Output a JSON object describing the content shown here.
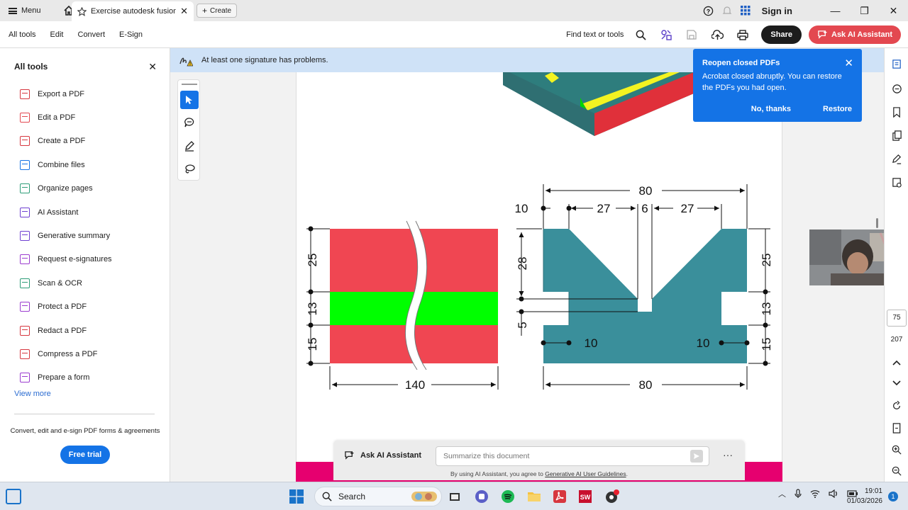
{
  "window": {
    "menu_label": "Menu",
    "tab_title": "Exercise autodesk fusion...",
    "create_label": "Create",
    "sign_in": "Sign in"
  },
  "toolbar": {
    "menus": [
      "All tools",
      "Edit",
      "Convert",
      "E-Sign"
    ],
    "find_text": "Find text or tools",
    "share_label": "Share",
    "ask_ai_label": "Ask AI Assistant"
  },
  "left_panel": {
    "title": "All tools",
    "items": [
      {
        "label": "Export a PDF",
        "icon": "export-pdf-icon",
        "color": "#d7373f"
      },
      {
        "label": "Edit a PDF",
        "icon": "edit-pdf-icon",
        "color": "#e34850"
      },
      {
        "label": "Create a PDF",
        "icon": "create-pdf-icon",
        "color": "#d7373f"
      },
      {
        "label": "Combine files",
        "icon": "combine-files-icon",
        "color": "#1473e6"
      },
      {
        "label": "Organize pages",
        "icon": "organize-pages-icon",
        "color": "#2d9d78"
      },
      {
        "label": "AI Assistant",
        "icon": "ai-assistant-icon",
        "color": "#6e3fd1"
      },
      {
        "label": "Generative summary",
        "icon": "generative-summary-icon",
        "color": "#6e3fd1"
      },
      {
        "label": "Request e-signatures",
        "icon": "request-esign-icon",
        "color": "#9b3ccf"
      },
      {
        "label": "Scan & OCR",
        "icon": "scan-ocr-icon",
        "color": "#2d9d78"
      },
      {
        "label": "Protect a PDF",
        "icon": "protect-pdf-icon",
        "color": "#9b3ccf"
      },
      {
        "label": "Redact a PDF",
        "icon": "redact-pdf-icon",
        "color": "#d7373f"
      },
      {
        "label": "Compress a PDF",
        "icon": "compress-pdf-icon",
        "color": "#d7373f"
      },
      {
        "label": "Prepare a form",
        "icon": "prepare-form-icon",
        "color": "#9b3ccf"
      }
    ],
    "view_more": "View more",
    "promo": "Convert, edit and e-sign PDF forms & agreements",
    "free_trial": "Free trial"
  },
  "banner": {
    "message": "At least one signature has problems."
  },
  "toast": {
    "title": "Reopen closed PDFs",
    "message": "Acrobat closed abruptly. You can restore the PDFs you had open.",
    "dismiss": "No, thanks",
    "restore": "Restore"
  },
  "drawing": {
    "left_dims": [
      "25",
      "13",
      "15"
    ],
    "bottom_left": "140",
    "top_total": "80",
    "top_parts": [
      "10",
      "27",
      "6",
      "27"
    ],
    "mid_left": [
      "28",
      "5"
    ],
    "slot_left": "10",
    "slot_right": "10",
    "right_dims": [
      "25",
      "13",
      "15"
    ],
    "bottom_right": "80"
  },
  "ai_bar": {
    "label": "Ask AI Assistant",
    "placeholder": "Summarize this document",
    "legal_prefix": "By using AI Assistant, you agree to ",
    "legal_link": "Generative AI User Guidelines",
    "legal_suffix": "."
  },
  "right_rail": {
    "page_current": "75",
    "page_total": "207"
  },
  "taskbar": {
    "search": "Search",
    "time": "19:01",
    "date": "01/03/2026",
    "notifications": "1"
  },
  "colors": {
    "accent_blue": "#1473e6",
    "ai_red": "#e34850",
    "drawing_red": "#f04652",
    "drawing_green": "#00ff00",
    "drawing_teal": "#3a8f9b",
    "footer_pink": "#e6006f"
  }
}
